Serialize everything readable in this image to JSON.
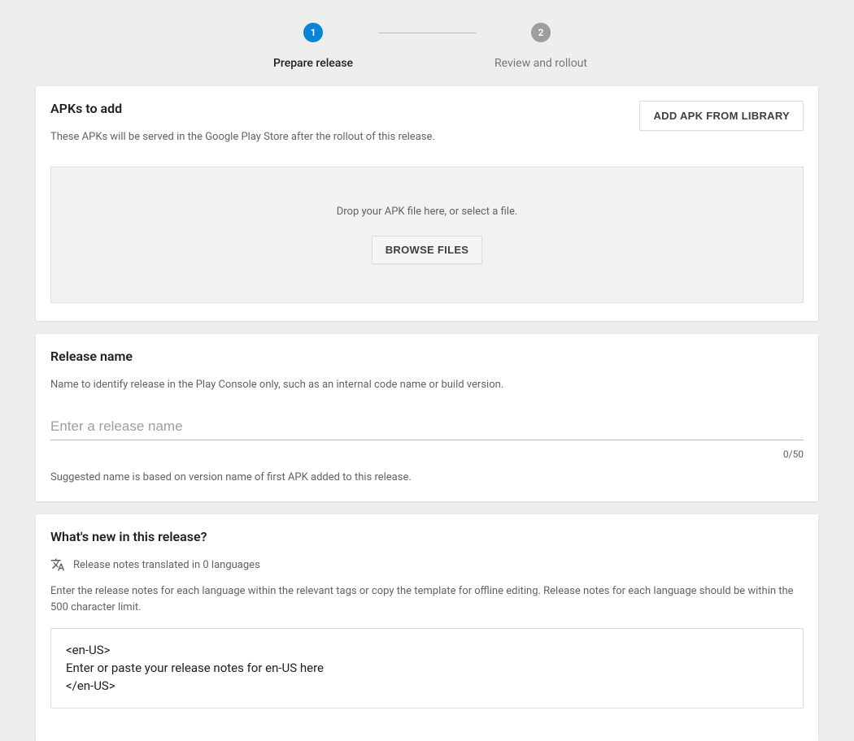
{
  "stepper": {
    "steps": [
      {
        "number": "1",
        "label": "Prepare release",
        "active": true
      },
      {
        "number": "2",
        "label": "Review and rollout",
        "active": false
      }
    ]
  },
  "apks": {
    "title": "APKs to add",
    "description": "These APKs will be served in the Google Play Store after the rollout of this release.",
    "add_from_library_label": "ADD APK FROM LIBRARY",
    "dropzone_text": "Drop your APK file here, or select a file.",
    "browse_label": "BROWSE FILES"
  },
  "release_name": {
    "title": "Release name",
    "description": "Name to identify release in the Play Console only, such as an internal code name or build version.",
    "placeholder": "Enter a release name",
    "value": "",
    "counter": "0/50",
    "hint": "Suggested name is based on version name of first APK added to this release."
  },
  "whats_new": {
    "title": "What's new in this release?",
    "translated_text": "Release notes translated in 0 languages",
    "description": "Enter the release notes for each language within the relevant tags or copy the template for offline editing. Release notes for each language should be within the 500 character limit.",
    "notes_template": "<en-US>\nEnter or paste your release notes for en-US here\n</en-US>"
  }
}
